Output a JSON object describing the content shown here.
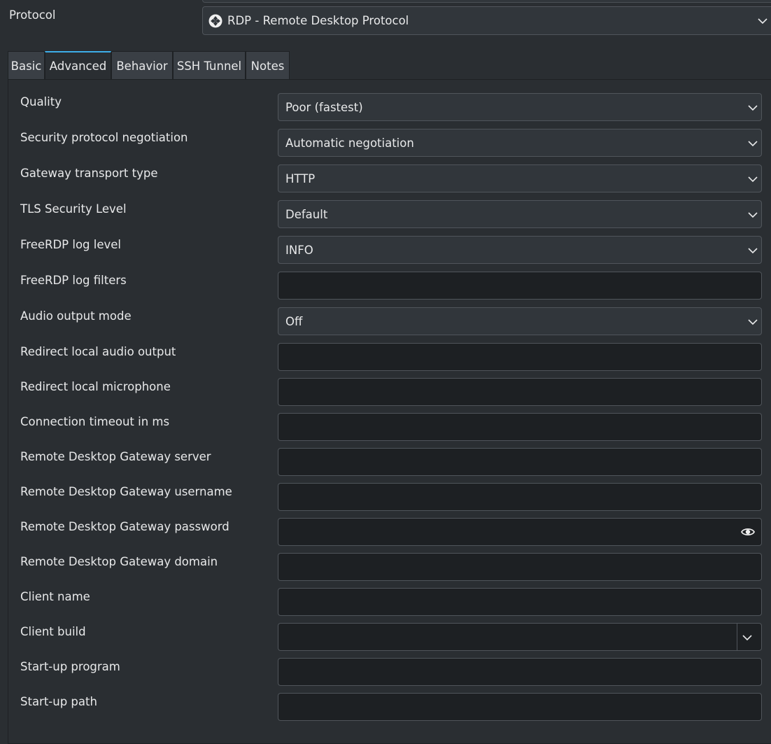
{
  "protocol": {
    "label": "Protocol",
    "selected": "RDP - Remote Desktop Protocol"
  },
  "tabs": [
    {
      "label": "Basic",
      "active": false
    },
    {
      "label": "Advanced",
      "active": true
    },
    {
      "label": "Behavior",
      "active": false
    },
    {
      "label": "SSH Tunnel",
      "active": false
    },
    {
      "label": "Notes",
      "active": false
    }
  ],
  "fields": [
    {
      "label": "Quality",
      "type": "combo",
      "value": "Poor (fastest)"
    },
    {
      "label": "Security protocol negotiation",
      "type": "combo",
      "value": "Automatic negotiation"
    },
    {
      "label": "Gateway transport type",
      "type": "combo",
      "value": "HTTP"
    },
    {
      "label": "TLS Security Level",
      "type": "combo",
      "value": "Default"
    },
    {
      "label": "FreeRDP log level",
      "type": "combo",
      "value": "INFO"
    },
    {
      "label": "FreeRDP log filters",
      "type": "input",
      "value": ""
    },
    {
      "label": "Audio output mode",
      "type": "combo",
      "value": "Off"
    },
    {
      "label": "Redirect local audio output",
      "type": "input",
      "value": ""
    },
    {
      "label": "Redirect local microphone",
      "type": "input",
      "value": ""
    },
    {
      "label": "Connection timeout in ms",
      "type": "input",
      "value": ""
    },
    {
      "label": "Remote Desktop Gateway server",
      "type": "input",
      "value": ""
    },
    {
      "label": "Remote Desktop Gateway username",
      "type": "input",
      "value": ""
    },
    {
      "label": "Remote Desktop Gateway password",
      "type": "password",
      "value": ""
    },
    {
      "label": "Remote Desktop Gateway domain",
      "type": "input",
      "value": ""
    },
    {
      "label": "Client name",
      "type": "input",
      "value": ""
    },
    {
      "label": "Client build",
      "type": "editable-combo",
      "value": ""
    },
    {
      "label": "Start-up program",
      "type": "input",
      "value": ""
    },
    {
      "label": "Start-up path",
      "type": "input",
      "value": ""
    }
  ],
  "icons": {
    "protocol": "rdp-protocol-icon",
    "dropdown": "chevron-down-icon",
    "reveal": "eye-icon"
  },
  "colors": {
    "background": "#2a2e32",
    "field": "#31363b",
    "input": "#1d2023",
    "accent": "#3daee9",
    "text": "#e8e9ea"
  }
}
